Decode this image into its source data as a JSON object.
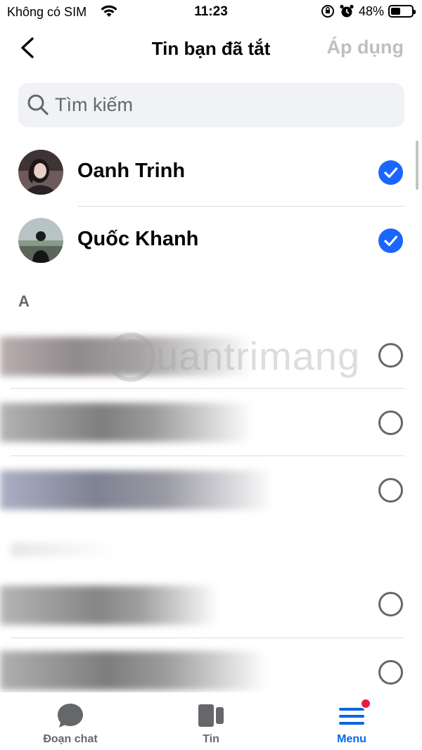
{
  "status_bar": {
    "carrier": "Không có SIM",
    "time": "11:23",
    "battery_percent": "48%",
    "battery_level": 0.48
  },
  "header": {
    "title": "Tin bạn đã tắt",
    "apply_label": "Áp dụng"
  },
  "search": {
    "placeholder": "Tìm kiếm"
  },
  "selected": [
    {
      "name": "Oanh Trinh",
      "checked": true
    },
    {
      "name": "Quốc Khanh",
      "checked": true
    }
  ],
  "section": {
    "letter": "A"
  },
  "contacts": [
    {
      "checked": false
    },
    {
      "checked": false
    },
    {
      "checked": false
    },
    {
      "checked": false
    },
    {
      "checked": false
    }
  ],
  "watermark": {
    "text": "uantrimang"
  },
  "tabbar": {
    "tabs": [
      {
        "label": "Đoạn chat",
        "icon": "chat-bubble-icon",
        "active": false
      },
      {
        "label": "Tin",
        "icon": "stories-icon",
        "active": false
      },
      {
        "label": "Menu",
        "icon": "menu-icon",
        "active": true,
        "badge": true
      }
    ]
  },
  "colors": {
    "accent": "#1b66ff",
    "apply_disabled": "#bcc0c4",
    "badge": "#e41e3f",
    "active_tab": "#0a66e5"
  }
}
